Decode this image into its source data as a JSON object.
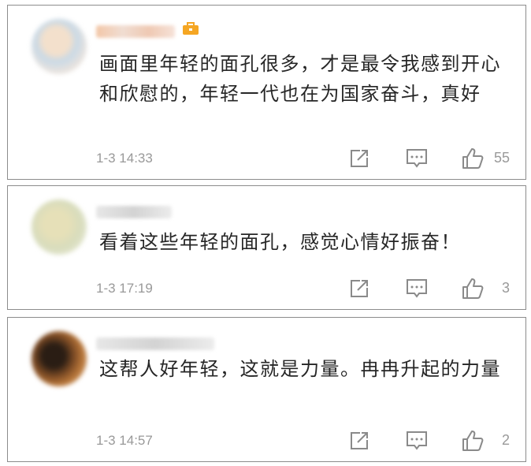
{
  "comments": [
    {
      "text": "画面里年轻的面孔很多，才是最令我感到开心和欣慰的，年轻一代也在为国家奋斗，真好",
      "time": "1-3 14:33",
      "likes": "55"
    },
    {
      "text": "看着这些年轻的面孔，感觉心情好振奋！",
      "time": "1-3 17:19",
      "likes": "3"
    },
    {
      "text": "这帮人好年轻，这就是力量。冉冉升起的力量",
      "time": "1-3 14:57",
      "likes": "2"
    }
  ],
  "colors": {
    "text": "#262626",
    "meta": "#999999",
    "vip_badge": "#f5a623",
    "card_border": "#8c8c8c"
  },
  "icons": [
    "share-icon",
    "comment-icon",
    "like-icon",
    "vip-badge-icon"
  ]
}
